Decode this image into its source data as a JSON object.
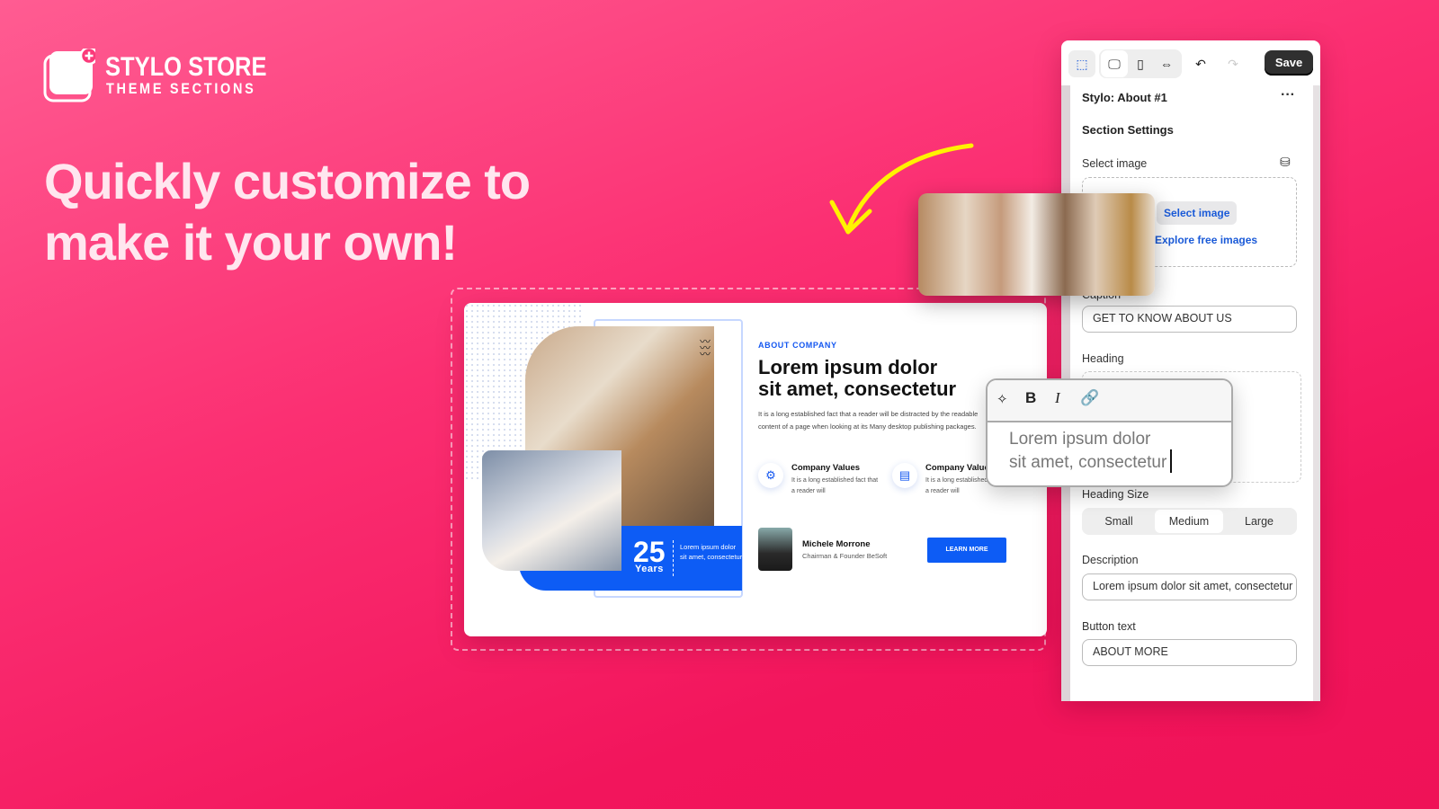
{
  "brand": {
    "name": "STYLO STORE",
    "tagline": "THEME SECTIONS"
  },
  "headline": {
    "line1": "Quickly customize to",
    "line2": "make it your own!"
  },
  "preview": {
    "eyebrow": "ABOUT COMPANY",
    "heading_line1": "Lorem ipsum dolor",
    "heading_line2": "sit amet, consectetur",
    "description": "It is a long established fact that a reader will be distracted by the readable content of a page when looking at its Many desktop publishing packages.",
    "features": [
      {
        "title": "Company Values",
        "text": "It is a long established fact that a reader will",
        "icon": "target-gear-icon"
      },
      {
        "title": "Company Values",
        "text": "It is a long established fact that a reader will",
        "icon": "document-icon"
      }
    ],
    "years": {
      "number": "25",
      "label": "Years",
      "text": "Lorem ipsum dolor sit amet, consectetur"
    },
    "person": {
      "name": "Michele Morrone",
      "role": "Chairman & Founder BeSoft"
    },
    "cta": "LEARN MORE",
    "accent": "#0d5cf5"
  },
  "panel": {
    "save": "Save",
    "section_title": "Stylo: About #1",
    "settings_title": "Section Settings",
    "select_image_label": "Select image",
    "select_image_button": "Select image",
    "explore_link": "Explore free images",
    "caption_label": "Caption",
    "caption_value": "GET TO KNOW ABOUT US",
    "heading_label": "Heading",
    "heading_size_label": "Heading Size",
    "heading_sizes": [
      "Small",
      "Medium",
      "Large"
    ],
    "heading_size_selected": "Medium",
    "description_label": "Description",
    "description_value": "Lorem ipsum dolor sit amet, consectetur",
    "button_text_label": "Button text",
    "button_text_value": "ABOUT MORE"
  },
  "editor": {
    "line1": "Lorem ipsum dolor",
    "line2": "sit amet, consectetur",
    "tools": [
      "ai-sparkle-icon",
      "bold-icon",
      "italic-icon",
      "link-icon"
    ]
  },
  "colors": {
    "background": "#f7246a",
    "accent": "#0d5cf5",
    "arrow": "#fff200"
  }
}
